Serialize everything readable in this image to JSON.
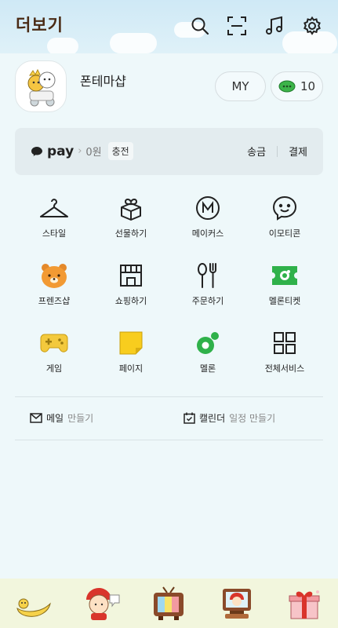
{
  "header": {
    "title": "더보기",
    "icons": [
      "search-icon",
      "scan-icon",
      "music-icon",
      "gear-icon"
    ]
  },
  "profile": {
    "name": "폰테마샵",
    "my_label": "MY",
    "coin_count": "10"
  },
  "pay": {
    "brand": "pay",
    "balance": "0원",
    "charge_label": "충전",
    "send_label": "송금",
    "payment_label": "결제"
  },
  "menu": {
    "items": [
      {
        "label": "스타일",
        "icon": "hanger-icon"
      },
      {
        "label": "선물하기",
        "icon": "gift-icon"
      },
      {
        "label": "메이커스",
        "icon": "makers-icon"
      },
      {
        "label": "이모티콘",
        "icon": "emoticon-icon"
      },
      {
        "label": "프렌즈샵",
        "icon": "friends-shop-icon"
      },
      {
        "label": "쇼핑하기",
        "icon": "shopping-icon"
      },
      {
        "label": "주문하기",
        "icon": "order-icon"
      },
      {
        "label": "멜론티켓",
        "icon": "ticket-icon"
      },
      {
        "label": "게임",
        "icon": "gamepad-icon"
      },
      {
        "label": "페이지",
        "icon": "page-icon"
      },
      {
        "label": "멜론",
        "icon": "melon-icon"
      },
      {
        "label": "전체서비스",
        "icon": "all-services-icon"
      }
    ]
  },
  "quick": {
    "mail_prefix": "메일",
    "mail_action": "만들기",
    "calendar_prefix": "캘린더",
    "calendar_action": "일정 만들기"
  },
  "colors": {
    "accent_brown": "#4a2a14",
    "pay_bg": "#e3ecef",
    "bottom_bg": "#f2f6dd"
  }
}
